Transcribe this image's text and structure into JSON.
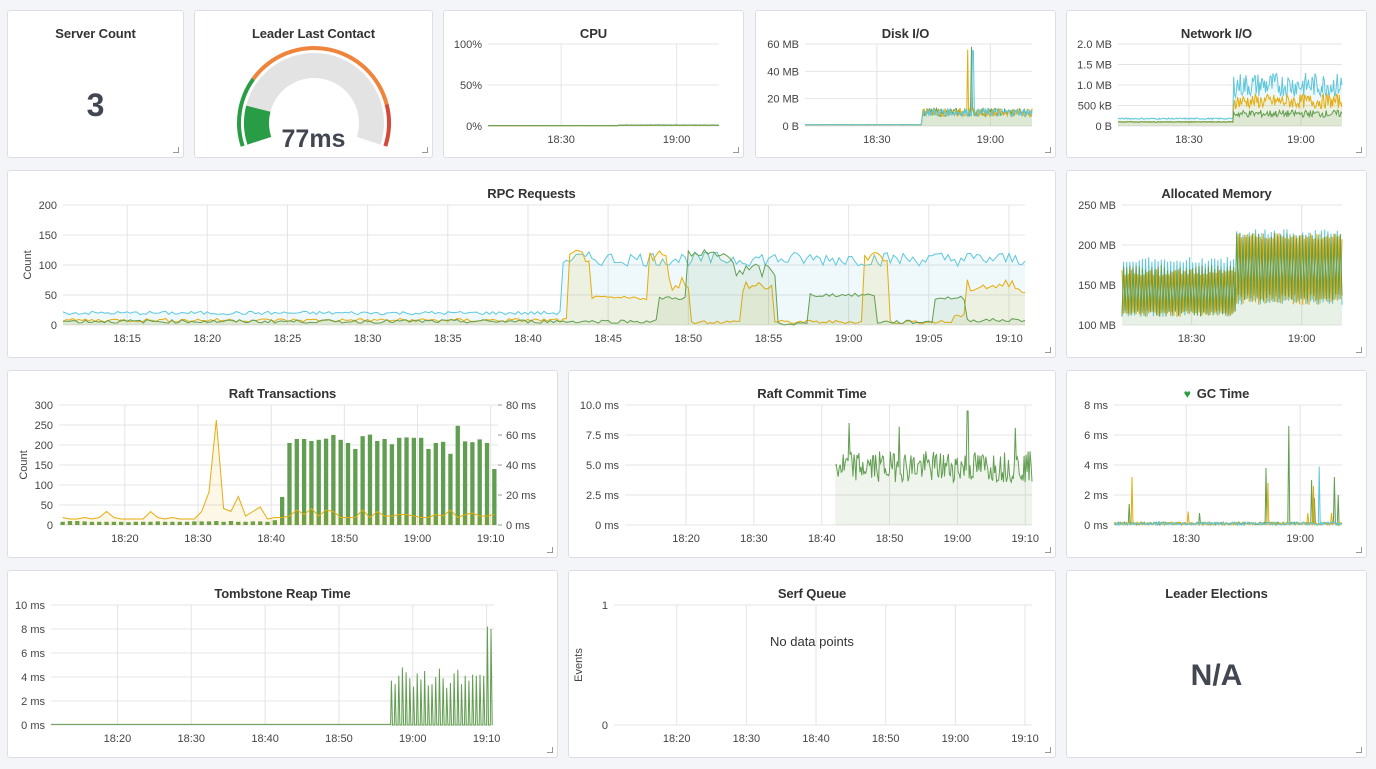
{
  "colors": {
    "green": "#629e51",
    "yellow": "#e5ac0e",
    "cyan": "#5ec7dc",
    "gauge_green": "#299c46",
    "gauge_orange": "#ef843c",
    "gauge_red": "#d44a3a",
    "gauge_bg": "#e3e3e3",
    "grid": "#e4e4e4"
  },
  "panels": {
    "server_count": {
      "title": "Server Count",
      "value": "3"
    },
    "leader_last_contact": {
      "title": "Leader Last Contact",
      "value": "77ms",
      "gauge_fraction": 0.15,
      "thresholds": {
        "green_end": 0.25,
        "orange_end": 0.85
      }
    },
    "cpu": {
      "title": "CPU"
    },
    "disk_io": {
      "title": "Disk I/O"
    },
    "network_io": {
      "title": "Network I/O"
    },
    "rpc_requests": {
      "title": "RPC Requests"
    },
    "allocated_memory": {
      "title": "Allocated Memory"
    },
    "raft_transactions": {
      "title": "Raft Transactions"
    },
    "raft_commit_time": {
      "title": "Raft Commit Time"
    },
    "gc_time": {
      "title": "GC Time",
      "icon": "heart-icon"
    },
    "tombstone_reap_time": {
      "title": "Tombstone Reap Time"
    },
    "serf_queue": {
      "title": "Serf Queue",
      "nodata": "No data points"
    },
    "leader_elections": {
      "title": "Leader Elections",
      "value": "N/A"
    }
  },
  "chart_data": [
    {
      "id": "cpu",
      "type": "line",
      "title": "CPU",
      "x_range": [
        "18:11",
        "19:11"
      ],
      "xticks": [
        "18:30",
        "19:00"
      ],
      "xtick_pos_min": [
        19,
        49
      ],
      "yticks": [
        "0%",
        "50%",
        "100%"
      ],
      "ylim": [
        0,
        100
      ],
      "series": [
        {
          "name": "s1",
          "color": "cyan",
          "level_before": 0.5,
          "level_after": 1.2,
          "change_at_min": 34
        },
        {
          "name": "s2",
          "color": "yellow",
          "level_before": 0.4,
          "level_after": 0.8,
          "change_at_min": 34
        },
        {
          "name": "s3",
          "color": "green",
          "level_before": 0.5,
          "level_after": 1.0,
          "change_at_min": 34
        }
      ]
    },
    {
      "id": "disk_io",
      "type": "area",
      "title": "Disk I/O",
      "xticks": [
        "18:30",
        "19:00"
      ],
      "xtick_pos_min": [
        19,
        49
      ],
      "yticks": [
        "0 B",
        "20 MB",
        "40 MB",
        "60 MB"
      ],
      "ylim": [
        0,
        60
      ],
      "series": [
        {
          "name": "s1",
          "color": "green",
          "level_before": 1,
          "level_after": 10,
          "change_at_min": 31,
          "spike_at_min": 44,
          "spike": 58
        },
        {
          "name": "s2",
          "color": "yellow",
          "level_before": 1,
          "level_after": 10,
          "change_at_min": 31,
          "spike_at_min": 43,
          "spike": 56
        },
        {
          "name": "s3",
          "color": "cyan",
          "level_before": 1,
          "level_after": 10,
          "change_at_min": 31,
          "spike_at_min": 44.4,
          "spike": 55
        }
      ]
    },
    {
      "id": "network_io",
      "type": "area",
      "title": "Network I/O",
      "xticks": [
        "18:30",
        "19:00"
      ],
      "xtick_pos_min": [
        19,
        49
      ],
      "yticks": [
        "0 B",
        "500 kB",
        "1.0 MB",
        "1.5 MB",
        "2.0 MB"
      ],
      "ylim": [
        0,
        2.0
      ],
      "series": [
        {
          "name": "s1",
          "color": "cyan",
          "level_before": 0.18,
          "level_after": 1.0,
          "change_at_min": 31
        },
        {
          "name": "s2",
          "color": "yellow",
          "level_before": 0.1,
          "level_after": 0.6,
          "change_at_min": 31
        },
        {
          "name": "s3",
          "color": "green",
          "level_before": 0.1,
          "level_after": 0.3,
          "change_at_min": 31
        }
      ]
    },
    {
      "id": "rpc_requests",
      "type": "area",
      "title": "RPC Requests",
      "ylabel": "Count",
      "xticks": [
        "18:15",
        "18:20",
        "18:25",
        "18:30",
        "18:35",
        "18:40",
        "18:45",
        "18:50",
        "18:55",
        "19:00",
        "19:05",
        "19:10"
      ],
      "xtick_pos_min": [
        4,
        9,
        14,
        19,
        24,
        29,
        34,
        39,
        44,
        49,
        54,
        59
      ],
      "yticks": [
        "0",
        "50",
        "100",
        "150",
        "200"
      ],
      "ylim": [
        0,
        200
      ],
      "series": [
        {
          "name": "s1",
          "color": "cyan",
          "segments": [
            [
              0,
              20
            ],
            [
              31.2,
              110
            ]
          ]
        },
        {
          "name": "s2",
          "color": "yellow",
          "segments": [
            [
              0,
              8
            ],
            [
              31.5,
              115
            ],
            [
              33,
              45
            ],
            [
              36.5,
              115
            ],
            [
              37.8,
              70
            ],
            [
              39.2,
              5
            ],
            [
              42.4,
              65
            ],
            [
              44.3,
              5
            ],
            [
              50,
              115
            ],
            [
              51.6,
              5
            ],
            [
              54,
              5
            ],
            [
              55.5,
              15
            ],
            [
              56.4,
              65
            ]
          ]
        },
        {
          "name": "s3",
          "color": "green",
          "segments": [
            [
              0,
              6
            ],
            [
              37.2,
              45
            ],
            [
              39,
              115
            ],
            [
              42,
              90
            ],
            [
              44.5,
              2
            ],
            [
              46.5,
              50
            ],
            [
              50.7,
              5
            ],
            [
              54.3,
              45
            ],
            [
              56.4,
              8
            ]
          ]
        }
      ]
    },
    {
      "id": "allocated_memory",
      "type": "line",
      "title": "Allocated Memory",
      "xticks": [
        "18:30",
        "19:00"
      ],
      "xtick_pos_min": [
        19,
        49
      ],
      "yticks": [
        "100 MB",
        "150 MB",
        "200 MB",
        "250 MB"
      ],
      "ylim": [
        100,
        250
      ],
      "series": [
        {
          "name": "s1",
          "color": "cyan",
          "sawtooth_before": [
            110,
            185
          ],
          "sawtooth_after": [
            125,
            220
          ],
          "change_at_min": 31
        },
        {
          "name": "s2",
          "color": "yellow",
          "sawtooth_before": [
            110,
            170
          ],
          "sawtooth_after": [
            125,
            215
          ],
          "change_at_min": 31
        },
        {
          "name": "s3",
          "color": "green",
          "sawtooth_before": [
            110,
            175
          ],
          "sawtooth_after": [
            130,
            215
          ],
          "change_at_min": 31
        }
      ]
    },
    {
      "id": "raft_transactions",
      "type": "bar",
      "title": "Raft Transactions",
      "ylabel": "Count",
      "xticks": [
        "18:20",
        "18:30",
        "18:40",
        "18:50",
        "19:00",
        "19:10"
      ],
      "xtick_pos_min": [
        9,
        19,
        29,
        39,
        49,
        59
      ],
      "yticks": [
        "0",
        "50",
        "100",
        "150",
        "200",
        "250",
        "300"
      ],
      "ylim": [
        0,
        300
      ],
      "y2ticks": [
        "0 ms",
        "20 ms",
        "40 ms",
        "60 ms",
        "80 ms"
      ],
      "y2lim": [
        0,
        80
      ],
      "bars": {
        "name": "count",
        "color": "green",
        "values": [
          8,
          10,
          10,
          9,
          8,
          8,
          8,
          8,
          8,
          7,
          8,
          8,
          8,
          9,
          8,
          8,
          8,
          8,
          9,
          9,
          9,
          10,
          8,
          10,
          8,
          8,
          9,
          9,
          8,
          12,
          70,
          205,
          215,
          215,
          210,
          213,
          216,
          225,
          213,
          205,
          190,
          222,
          226,
          210,
          215,
          202,
          218,
          219,
          218,
          218,
          190,
          205,
          208,
          178,
          248,
          209,
          207,
          214,
          205,
          140
        ]
      },
      "line": {
        "name": "latency_ms",
        "color": "yellow",
        "axis": "right",
        "values": [
          5,
          4,
          4,
          5,
          4,
          5,
          9,
          5,
          4,
          4,
          4,
          4,
          9,
          5,
          4,
          5,
          4,
          4,
          4,
          9,
          22,
          70,
          11,
          9,
          19,
          6,
          9,
          12,
          4,
          5,
          5,
          6,
          10,
          7,
          11,
          6,
          10,
          9,
          5,
          5,
          5,
          10,
          5,
          9,
          6,
          6,
          7,
          7,
          6,
          5,
          5,
          7,
          6,
          10,
          5,
          7,
          8,
          6,
          6,
          7
        ]
      }
    },
    {
      "id": "raft_commit_time",
      "type": "area",
      "title": "Raft Commit Time",
      "xticks": [
        "18:20",
        "18:30",
        "18:40",
        "18:50",
        "19:00",
        "19:10"
      ],
      "xtick_pos_min": [
        9,
        19,
        29,
        39,
        49,
        59
      ],
      "yticks": [
        "0 ms",
        "2.5 ms",
        "5.0 ms",
        "7.5 ms",
        "10.0 ms"
      ],
      "ylim": [
        0,
        10
      ],
      "series": [
        {
          "name": "commit",
          "color": "green",
          "start_min": 31,
          "mean": 4.6,
          "peaks": [
            [
              33,
              8.5
            ],
            [
              40.4,
              8.2
            ],
            [
              50.5,
              9.5
            ],
            [
              57.5,
              8.1
            ]
          ]
        }
      ]
    },
    {
      "id": "gc_time",
      "type": "line",
      "title": "GC Time",
      "xticks": [
        "18:30",
        "19:00"
      ],
      "xtick_pos_min": [
        19,
        49
      ],
      "yticks": [
        "0 ms",
        "2 ms",
        "4 ms",
        "6 ms",
        "8 ms"
      ],
      "ylim": [
        0,
        8
      ],
      "series": [
        {
          "name": "s1",
          "color": "green",
          "spikes": [
            [
              4,
              1.4
            ],
            [
              22.5,
              0.8
            ],
            [
              40,
              3.8
            ],
            [
              46,
              6.6
            ],
            [
              52,
              3.0
            ],
            [
              52.8,
              1.8
            ],
            [
              58,
              3.2
            ],
            [
              59,
              2.0
            ]
          ]
        },
        {
          "name": "s2",
          "color": "yellow",
          "spikes": [
            [
              4.7,
              3.2
            ],
            [
              19.5,
              0.9
            ],
            [
              40.6,
              2.8
            ],
            [
              51,
              0.8
            ],
            [
              52.4,
              2.6
            ],
            [
              57.2,
              0.8
            ]
          ]
        },
        {
          "name": "s3",
          "color": "cyan",
          "spikes": [
            [
              54,
              3.9
            ]
          ]
        }
      ]
    },
    {
      "id": "tombstone_reap_time",
      "type": "line",
      "title": "Tombstone Reap Time",
      "xticks": [
        "18:20",
        "18:30",
        "18:40",
        "18:50",
        "19:00",
        "19:10"
      ],
      "xtick_pos_min": [
        9,
        19,
        29,
        39,
        49,
        59
      ],
      "yticks": [
        "0 ms",
        "2 ms",
        "4 ms",
        "6 ms",
        "8 ms",
        "10 ms"
      ],
      "ylim": [
        0,
        10
      ],
      "series": [
        {
          "name": "reap",
          "color": "green",
          "start_min": 46,
          "spike_values": [
            3.7,
            3.4,
            4.1,
            4.8,
            4.4,
            3.9,
            3.2,
            4.3,
            3.8,
            4.5,
            3.3,
            3.4,
            4.0,
            4.7,
            3.9,
            3.1,
            3.5,
            4.3,
            4.6,
            3.4,
            4.1,
            3.7,
            4.2,
            4.1,
            4.2,
            4.1,
            8.2,
            8.0
          ]
        }
      ]
    },
    {
      "id": "serf_queue",
      "type": "line",
      "title": "Serf Queue",
      "ylabel": "Events",
      "xticks": [
        "18:20",
        "18:30",
        "18:40",
        "18:50",
        "19:00",
        "19:10"
      ],
      "xtick_pos_min": [
        9,
        19,
        29,
        39,
        49,
        59
      ],
      "yticks": [
        "0",
        "1"
      ],
      "ylim": [
        0,
        1
      ],
      "series": []
    }
  ]
}
